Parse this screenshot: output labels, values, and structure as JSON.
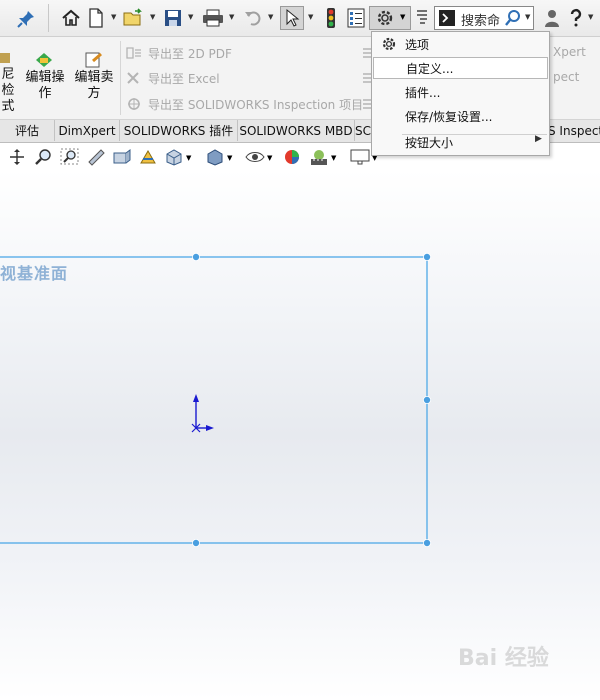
{
  "toolbar": {
    "search_placeholder": "搜索命"
  },
  "ribbon": {
    "check_label_line1": "尼检",
    "check_label_line2": "式",
    "edit_op_line1": "编辑操",
    "edit_op_line2": "作",
    "edit_sell_line1": "编辑卖",
    "edit_sell_line2": "方",
    "export_2d_pdf": "导出至 2D PDF",
    "export_excel": "导出至 Excel",
    "export_inspection": "导出至 SOLIDWORKS Inspection 项目",
    "right_partial_1": "Xpert",
    "right_partial_2": "pect"
  },
  "tabs": [
    {
      "label": "评估"
    },
    {
      "label": "DimXpert"
    },
    {
      "label": "SOLIDWORKS 插件"
    },
    {
      "label": "SOLIDWORKS MBD"
    },
    {
      "label": "SC"
    },
    {
      "label": "S Inspection"
    }
  ],
  "canvas": {
    "plane_label": "视基准面"
  },
  "menu": {
    "items": [
      {
        "label": "选项"
      },
      {
        "label": "自定义..."
      },
      {
        "label": "插件..."
      },
      {
        "label": "保存/恢复设置..."
      },
      {
        "label": "按钮大小"
      }
    ],
    "submenu_arrow": "▶"
  },
  "watermark": {
    "text": "Bai 经验"
  },
  "colors": {
    "selection_blue": "#4aa3e6",
    "plane_label": "#8fb2d6",
    "axis_blue": "#1a1ad0"
  }
}
